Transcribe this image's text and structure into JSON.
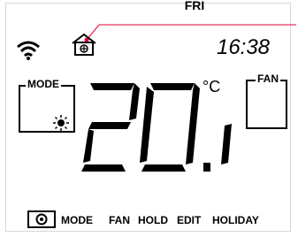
{
  "status": {
    "day": "FRI",
    "time": "16:38",
    "temperature": "20.1",
    "unit": "°C"
  },
  "labels": {
    "mode": "MODE",
    "fan": "FAN"
  },
  "menu": [
    "MODE",
    "FAN",
    "HOLD",
    "EDIT",
    "HOLIDAY"
  ],
  "icons": {
    "wifi": "wifi-icon",
    "home": "house-fan-icon",
    "mode": "sun-icon",
    "power": "power-icon"
  },
  "colors": {
    "accent": "#e8003a",
    "lcd": "#000000",
    "background": "#ffffff"
  }
}
